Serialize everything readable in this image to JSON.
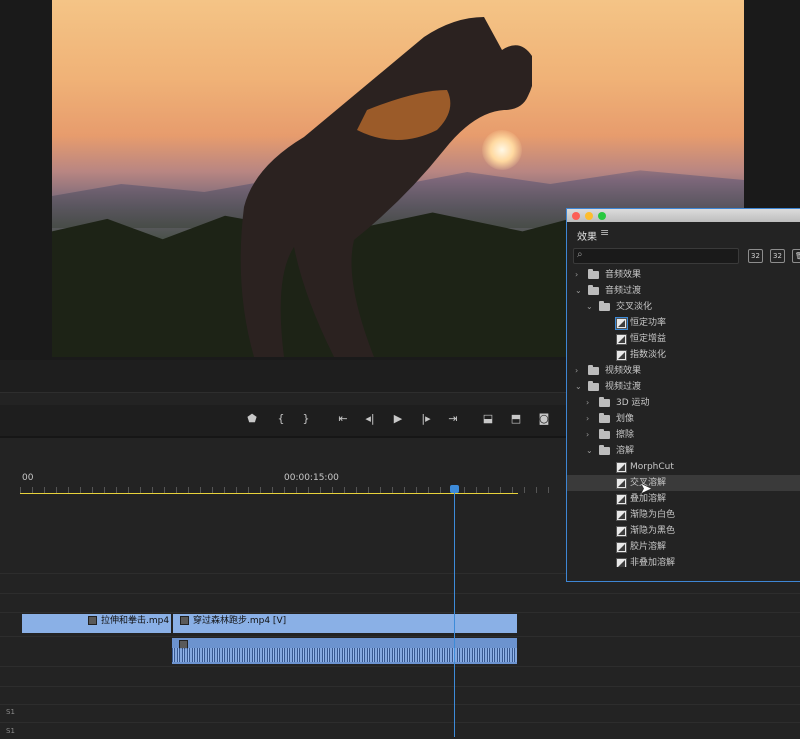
{
  "program_monitor": {
    "video_description_icon": "video-frame"
  },
  "transport": {
    "buttons": [
      "add-marker-icon",
      "mark-in-icon",
      "mark-out-icon",
      "go-to-in-icon",
      "step-back-icon",
      "play-icon",
      "step-forward-icon",
      "go-to-out-icon",
      "lift-icon",
      "extract-icon",
      "export-frame-icon"
    ]
  },
  "timeline": {
    "timecode_start": "00",
    "timecode_mid": "00:00:15:00",
    "clip1_label": "拉伸和拳击.mp4",
    "clip2_label": "穿过森林跑步.mp4 [V]",
    "track_label_a": "S1",
    "track_label_b": "S1"
  },
  "effects_panel": {
    "title": "效果",
    "menu_icon": "≡",
    "search_placeholder": "",
    "buttons": [
      "32",
      "32",
      "🗑"
    ],
    "tree": [
      {
        "label": "音频效果",
        "level": 0,
        "expanded": false,
        "type": "folder"
      },
      {
        "label": "音频过渡",
        "level": 0,
        "expanded": true,
        "type": "folder"
      },
      {
        "label": "交叉淡化",
        "level": 1,
        "expanded": true,
        "type": "folder"
      },
      {
        "label": "恒定功率",
        "level": 2,
        "type": "effect",
        "highlight": true
      },
      {
        "label": "恒定增益",
        "level": 2,
        "type": "effect"
      },
      {
        "label": "指数淡化",
        "level": 2,
        "type": "effect"
      },
      {
        "label": "视频效果",
        "level": 0,
        "expanded": false,
        "type": "folder"
      },
      {
        "label": "视频过渡",
        "level": 0,
        "expanded": true,
        "type": "folder"
      },
      {
        "label": "3D 运动",
        "level": 1,
        "expanded": false,
        "type": "folder"
      },
      {
        "label": "划像",
        "level": 1,
        "expanded": false,
        "type": "folder"
      },
      {
        "label": "擦除",
        "level": 1,
        "expanded": false,
        "type": "folder"
      },
      {
        "label": "溶解",
        "level": 1,
        "expanded": true,
        "type": "folder"
      },
      {
        "label": "MorphCut",
        "level": 2,
        "type": "effect"
      },
      {
        "label": "交叉溶解",
        "level": 2,
        "type": "effect",
        "selected": true
      },
      {
        "label": "叠加溶解",
        "level": 2,
        "type": "effect"
      },
      {
        "label": "渐隐为白色",
        "level": 2,
        "type": "effect"
      },
      {
        "label": "渐隐为黑色",
        "level": 2,
        "type": "effect"
      },
      {
        "label": "胶片溶解",
        "level": 2,
        "type": "effect"
      },
      {
        "label": "非叠加溶解",
        "level": 2,
        "type": "effect"
      }
    ]
  },
  "colors": {
    "accent_blue": "#3d8bd9",
    "clip_blue": "#8ab0e6",
    "ruler_yellow": "#e8d23b"
  }
}
